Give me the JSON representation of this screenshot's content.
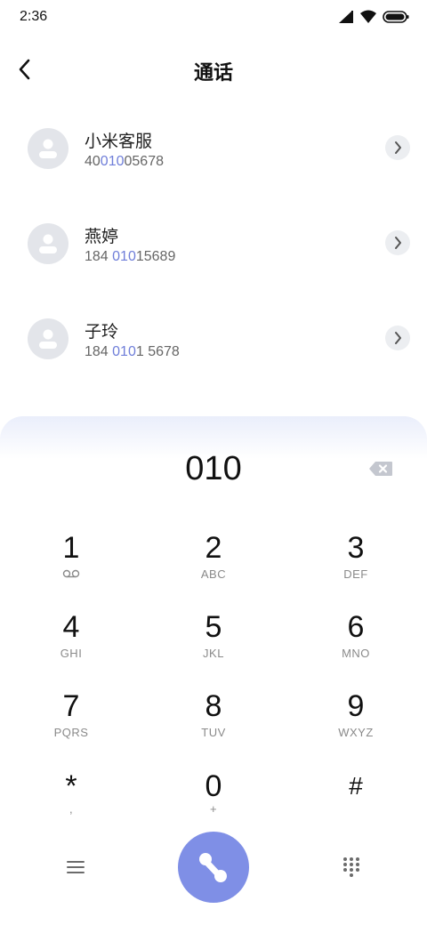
{
  "status_bar": {
    "time": "2:36"
  },
  "header": {
    "title": "通话"
  },
  "contacts": [
    {
      "name": "小米客服",
      "number_pre": "40",
      "number_match": "010",
      "number_post": "05678"
    },
    {
      "name": "燕婷",
      "number_pre": "184 ",
      "number_match": "010",
      "number_post": "15689"
    },
    {
      "name": "子玲",
      "number_pre": "184 ",
      "number_match": "010",
      "number_post": "1 5678"
    }
  ],
  "dialer": {
    "input": "010",
    "keys": [
      {
        "digit": "1",
        "letters": ""
      },
      {
        "digit": "2",
        "letters": "ABC"
      },
      {
        "digit": "3",
        "letters": "DEF"
      },
      {
        "digit": "4",
        "letters": "GHI"
      },
      {
        "digit": "5",
        "letters": "JKL"
      },
      {
        "digit": "6",
        "letters": "MNO"
      },
      {
        "digit": "7",
        "letters": "PQRS"
      },
      {
        "digit": "8",
        "letters": "TUV"
      },
      {
        "digit": "9",
        "letters": "WXYZ"
      },
      {
        "digit": "*",
        "letters": ","
      },
      {
        "digit": "0",
        "letters": "+"
      },
      {
        "digit": "#",
        "letters": ""
      }
    ]
  },
  "colors": {
    "accent": "#7f8fe6",
    "match_highlight": "#6f7ed9"
  },
  "icons": [
    "back-arrow-icon",
    "voicemail-icon",
    "backspace-icon",
    "menu-icon",
    "phone-icon",
    "keypad-icon"
  ]
}
